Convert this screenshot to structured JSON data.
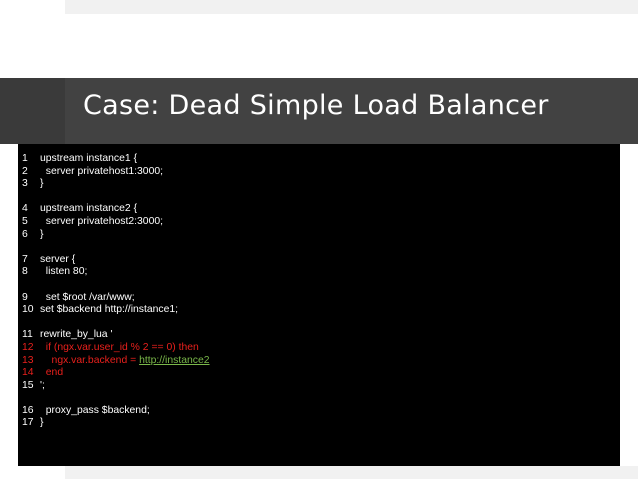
{
  "slide": {
    "title": "Case: Dead Simple Load Balancer"
  },
  "code": {
    "lines": [
      {
        "n": "1",
        "text": "upstream instance1 {"
      },
      {
        "n": "2",
        "text": "  server privatehost1:3000;"
      },
      {
        "n": "3",
        "text": "}"
      },
      {
        "n": "4",
        "text": "upstream instance2 {"
      },
      {
        "n": "5",
        "text": "  server privatehost2:3000;"
      },
      {
        "n": "6",
        "text": "}"
      },
      {
        "n": "7",
        "text": "server {"
      },
      {
        "n": "8",
        "text": "  listen 80;"
      },
      {
        "n": "9",
        "text": "  set $root /var/www;"
      },
      {
        "n": "10",
        "text": "set $backend http://instance1;"
      },
      {
        "n": "11",
        "text": "rewrite_by_lua '"
      },
      {
        "n": "12",
        "text": "  if (ngx.var.user_id % 2 == 0) then"
      },
      {
        "n": "13",
        "text": "    ngx.var.backend = ",
        "link": "http://instance2"
      },
      {
        "n": "14",
        "text": "  end"
      },
      {
        "n": "15",
        "text": "';"
      },
      {
        "n": "16",
        "text": "  proxy_pass $backend;"
      },
      {
        "n": "17",
        "text": "}"
      }
    ]
  },
  "colors": {
    "title_bar": "#424242",
    "code_background": "#000000",
    "code_text": "#ffffff",
    "highlight_red": "#e8201c",
    "link_green": "#7ab84a"
  }
}
